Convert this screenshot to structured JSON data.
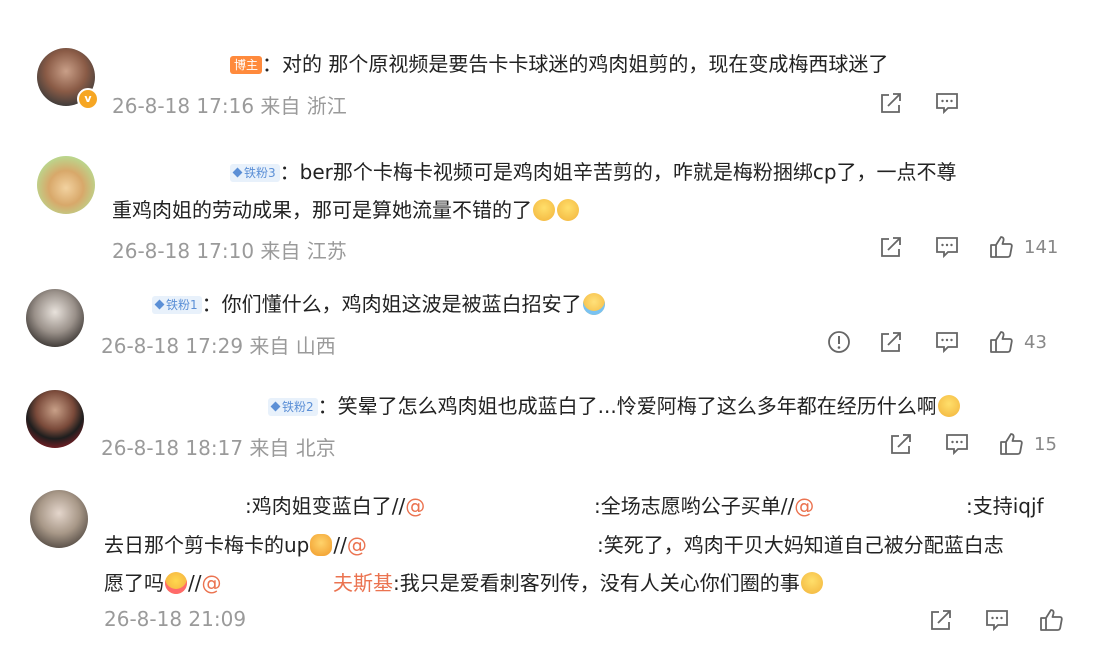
{
  "comments": [
    {
      "badge": "博主",
      "segments": [
        "：对的 那个原视频是要告卡卡球迷的鸡肉姐剪的，现在变成梅西球迷了"
      ],
      "time": "26-8-18 17:16",
      "source": "来自 浙江",
      "likes": ""
    },
    {
      "badge": "铁粉3",
      "line1": "：ber那个卡梅卡视频可是鸡肉姐辛苦剪的，咋就是梅粉捆绑cp了，一点不尊",
      "line2": "重鸡肉姐的劳动成果，那可是算她流量不错的了",
      "time": "26-8-18 17:10",
      "source": "来自 江苏",
      "likes": "141"
    },
    {
      "badge": "铁粉1",
      "text": "：你们懂什么，鸡肉姐这波是被蓝白招安了",
      "time": "26-8-18 17:29",
      "source": "来自 山西",
      "likes": "43"
    },
    {
      "badge": "铁粉2",
      "text": "：笑晕了怎么鸡肉姐也成蓝白了...怜爱阿梅了这么多年都在经历什么啊",
      "time": "26-8-18 18:17",
      "source": "来自 北京",
      "likes": "15"
    },
    {
      "l1_a": ":鸡肉姐变蓝白了//",
      "l1_at1": "@",
      "l1_b": ":全场志愿哟公子买单//",
      "l1_at2": "@",
      "l1_c": ":支持iqjf",
      "l2_a": "去日那个剪卡梅卡的up",
      "l2_b": "//",
      "l2_at": "@",
      "l2_c": ":笑死了，鸡肉干贝大妈知道自己被分配蓝白志",
      "l3_a": "愿了吗",
      "l3_b": "//",
      "l3_at": "@",
      "l3_name": "夫斯基",
      "l3_c": ":我只是爱看刺客列传，没有人关心你们圈的事",
      "time": "26-8-18 21:09",
      "likes": ""
    }
  ],
  "icons": {
    "share": "share-icon",
    "comment": "comment-icon",
    "like": "thumbs-up-icon",
    "report": "report-icon"
  },
  "colors": {
    "mention": "#eb7350",
    "meta_gray": "#9a9a9a",
    "host_badge": "#ff8a3c",
    "fan_badge_text": "#5b8fd6"
  }
}
